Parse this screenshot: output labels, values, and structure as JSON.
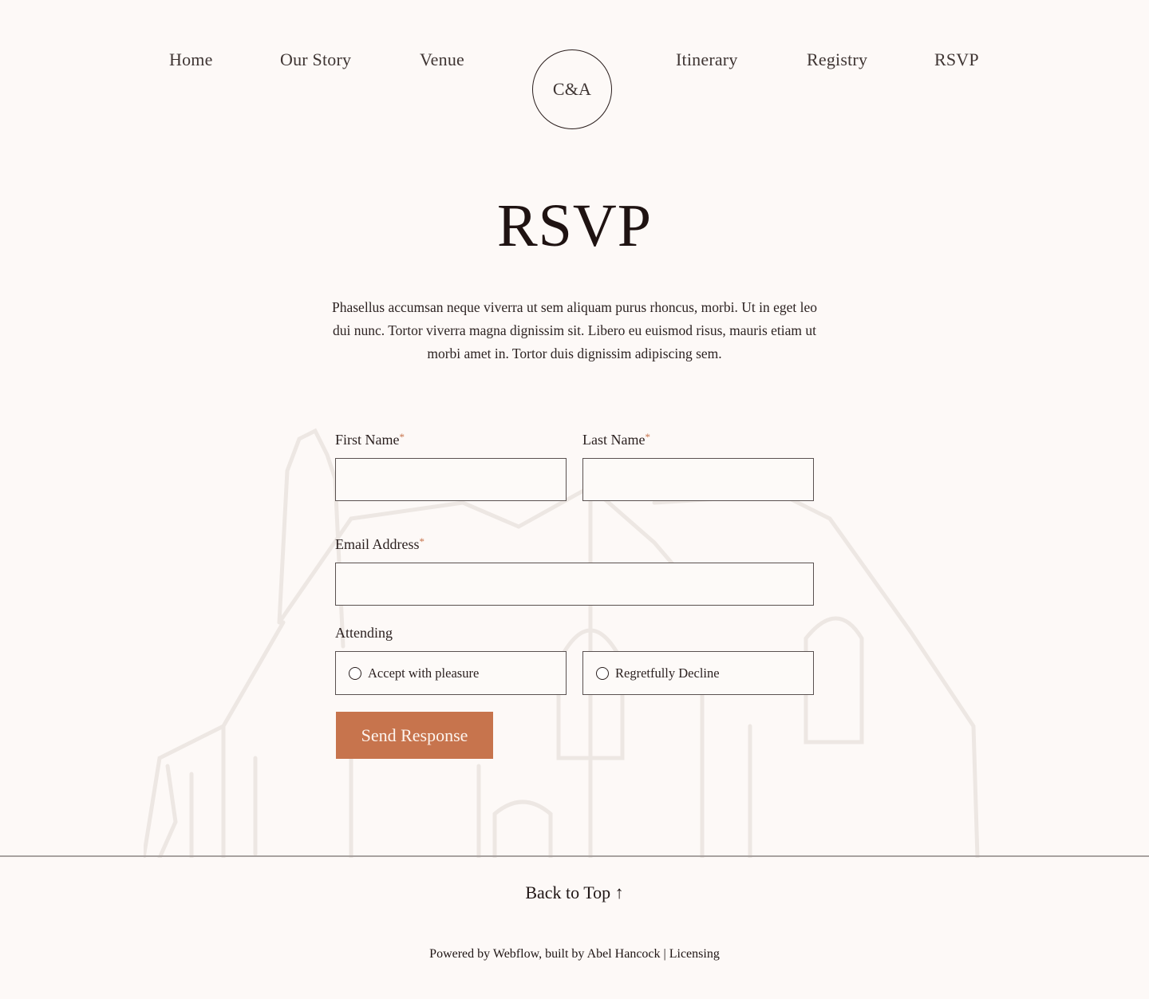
{
  "nav": {
    "left_items": [
      {
        "label": "Home"
      },
      {
        "label": "Our Story"
      },
      {
        "label": "Venue"
      }
    ],
    "logo": "C&A",
    "right_items": [
      {
        "label": "Itinerary"
      },
      {
        "label": "Registry"
      },
      {
        "label": "RSVP"
      }
    ]
  },
  "page": {
    "title": "RSVP",
    "intro": "Phasellus accumsan neque viverra ut sem aliquam purus rhoncus, morbi. Ut in eget leo dui nunc. Tortor viverra magna dignissim sit. Libero eu euismod risus, mauris etiam ut morbi amet in. Tortor duis dignissim adipiscing sem."
  },
  "form": {
    "required_mark": "*",
    "first_name": {
      "label": "First Name",
      "value": "",
      "placeholder": ""
    },
    "last_name": {
      "label": "Last Name",
      "value": "",
      "placeholder": ""
    },
    "email": {
      "label": "Email Address",
      "value": "",
      "placeholder": ""
    },
    "attending": {
      "label": "Attending",
      "options": [
        {
          "label": "Accept with pleasure",
          "selected": false
        },
        {
          "label": "Regretfully Decline",
          "selected": false
        }
      ]
    },
    "submit_label": "Send Response",
    "accent_color": "#c7744d"
  },
  "footer": {
    "back_to_top": "Back to Top",
    "back_to_top_icon": "arrow-up-icon",
    "arrow_glyph": "↑",
    "powered_prefix": "Powered by",
    "webflow": "Webflow",
    "built_by_prefix": ", built by",
    "author": "Abel Hancock",
    "separator": "|",
    "licensing": "Licensing"
  }
}
